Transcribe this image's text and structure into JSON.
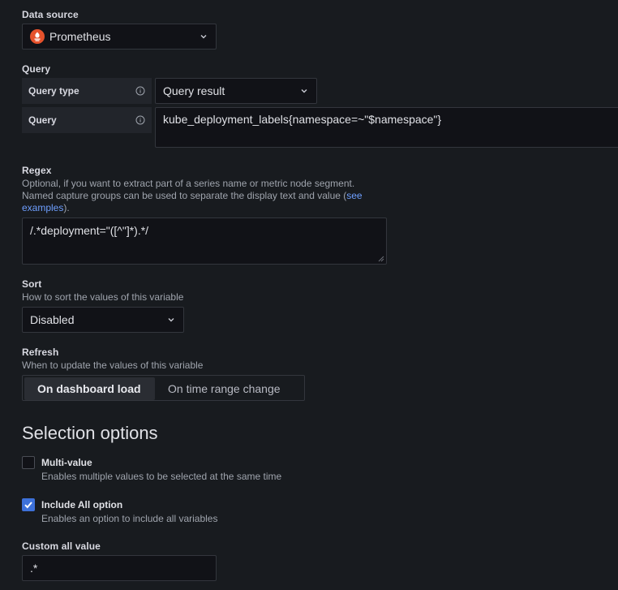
{
  "data_source": {
    "label": "Data source",
    "selected": "Prometheus",
    "icon": "prometheus-icon"
  },
  "query": {
    "label": "Query",
    "query_type_label": "Query type",
    "query_type_value": "Query result",
    "query_field_label": "Query",
    "query_value": "kube_deployment_labels{namespace=~\"$namespace\"}"
  },
  "regex": {
    "label": "Regex",
    "desc_line1": "Optional, if you want to extract part of a series name or metric node segment.",
    "desc_line2a": "Named capture groups can be used to separate the display text and value (",
    "desc_link_a": "see",
    "desc_link_b": "examples",
    "desc_line3_tail": ").",
    "value": "/.*deployment=\"([^\"]*).*/"
  },
  "sort": {
    "label": "Sort",
    "desc": "How to sort the values of this variable",
    "value": "Disabled"
  },
  "refresh": {
    "label": "Refresh",
    "desc": "When to update the values of this variable",
    "options": [
      "On dashboard load",
      "On time range change"
    ],
    "selected": "On dashboard load"
  },
  "selection": {
    "heading": "Selection options",
    "multi_value": {
      "title": "Multi-value",
      "desc": "Enables multiple values to be selected at the same time",
      "checked": false
    },
    "include_all": {
      "title": "Include All option",
      "desc": "Enables an option to include all variables",
      "checked": true
    }
  },
  "custom_all": {
    "label": "Custom all value",
    "value": ".*"
  },
  "colors": {
    "background": "#181b1f",
    "accent": "#3d71d9",
    "link": "#6e9fff",
    "prometheus": "#e6522c"
  }
}
